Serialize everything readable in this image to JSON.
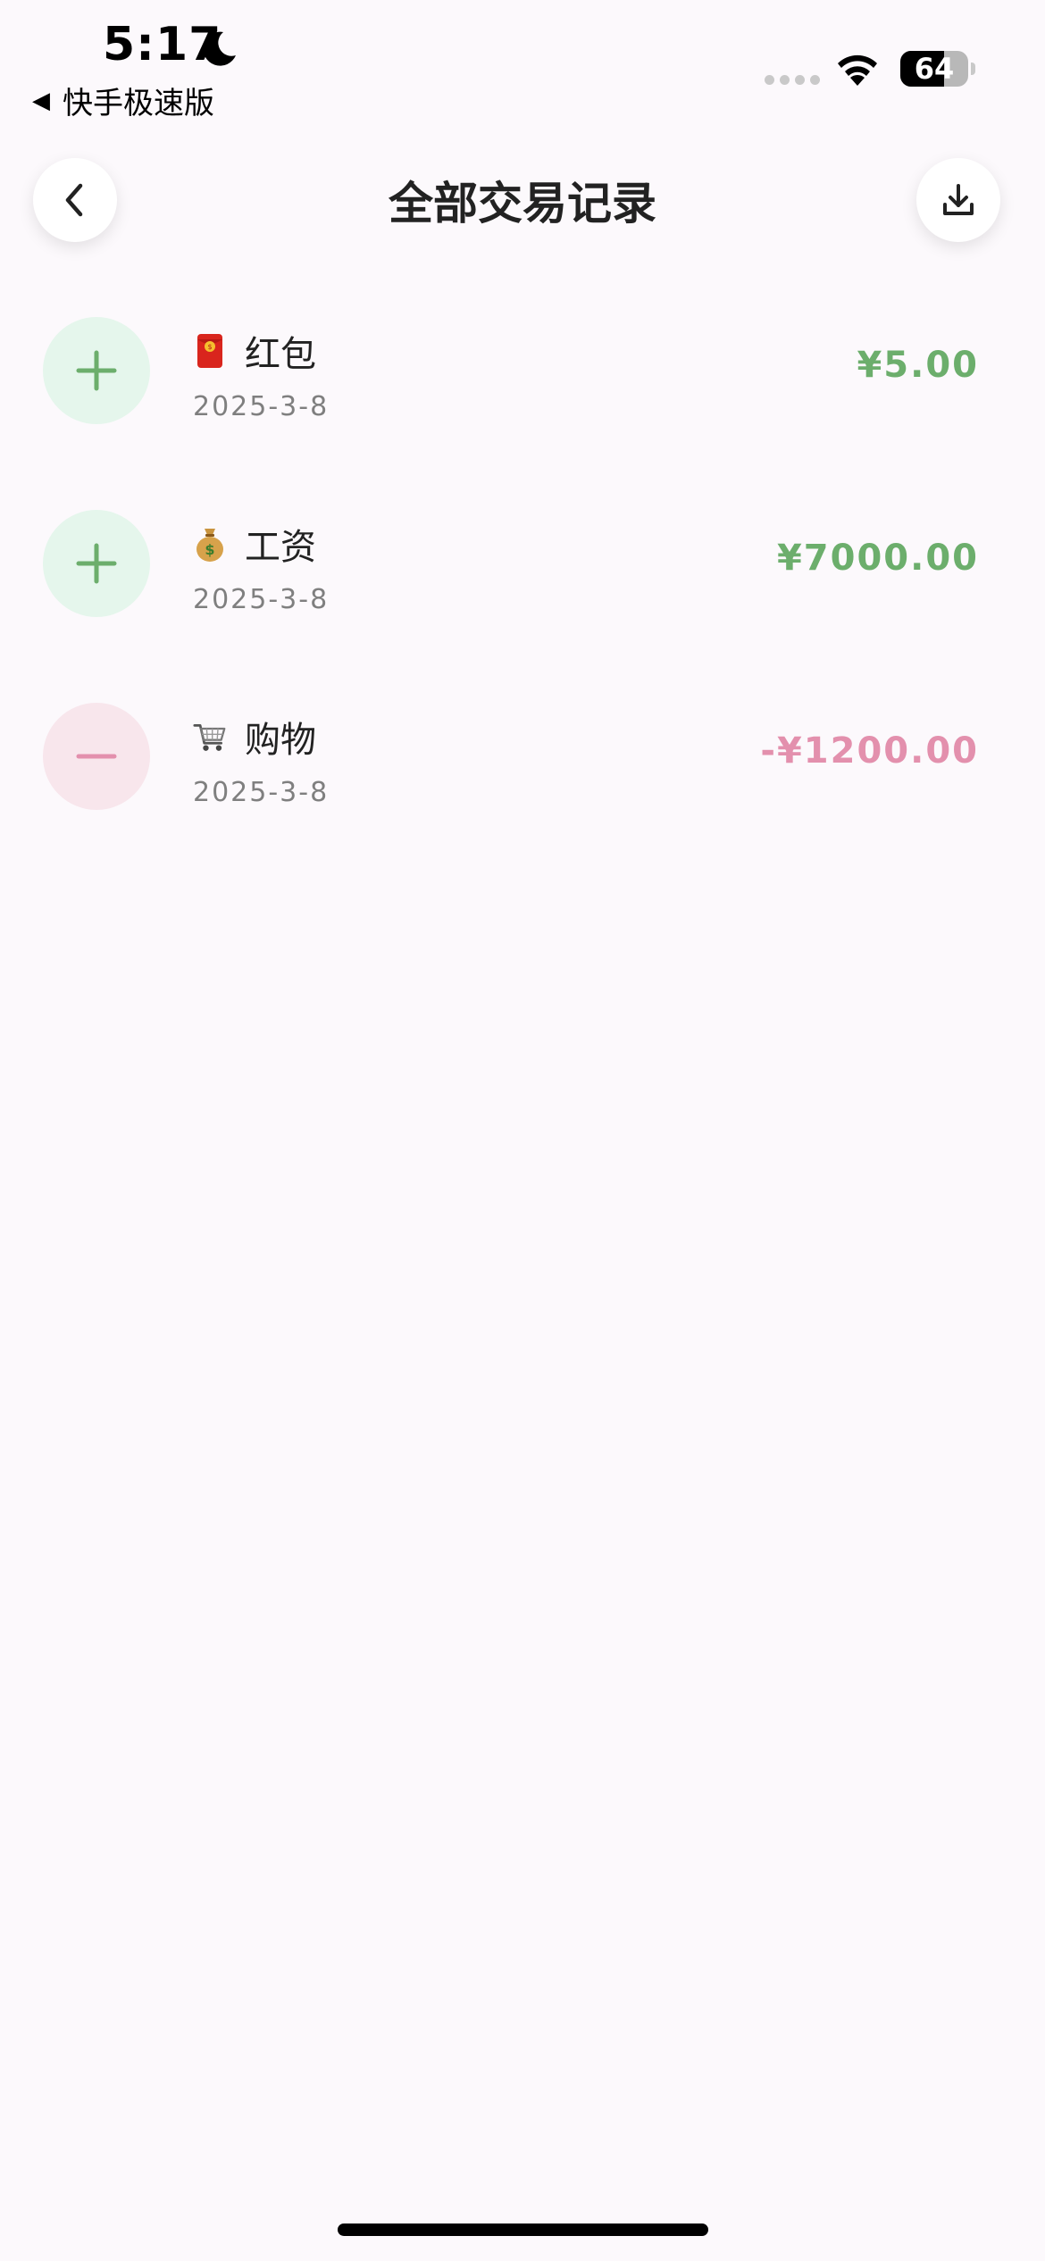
{
  "status_bar": {
    "time": "5:17",
    "back_app_label": "快手极速版",
    "battery_level": "64"
  },
  "header": {
    "title": "全部交易记录"
  },
  "transactions": [
    {
      "type": "income",
      "icon": "red-envelope-icon",
      "label": "红包",
      "date": "2025-3-8",
      "amount": "¥5.00"
    },
    {
      "type": "income",
      "icon": "money-bag-icon",
      "label": "工资",
      "date": "2025-3-8",
      "amount": "¥7000.00"
    },
    {
      "type": "expense",
      "icon": "shopping-cart-icon",
      "label": "购物",
      "date": "2025-3-8",
      "amount": "-¥1200.00"
    }
  ],
  "colors": {
    "income": "#6cae6c",
    "expense": "#e390ad",
    "income_bg": "#e5f6ec",
    "expense_bg": "#f8e6ec",
    "background": "#fcf9fc"
  }
}
